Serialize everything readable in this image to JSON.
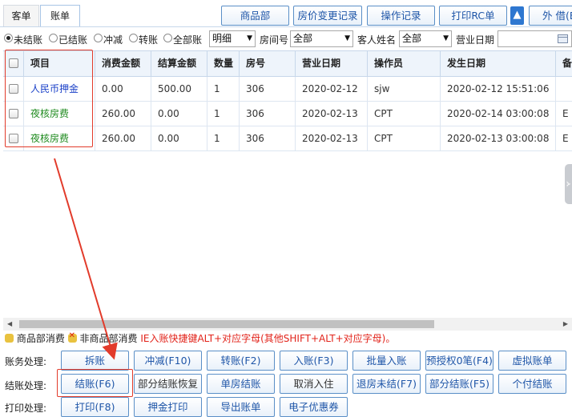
{
  "tabs": [
    {
      "label": "客单",
      "active": false
    },
    {
      "label": "账单",
      "active": true
    }
  ],
  "toolbar": {
    "buttons": [
      "商品部",
      "房价变更记录",
      "操作记录",
      "打印RC单"
    ],
    "up_icon": "▲",
    "partial": "外 借(B)"
  },
  "filter": {
    "radios": [
      {
        "label": "未结账",
        "checked": true
      },
      {
        "label": "已结账",
        "checked": false
      },
      {
        "label": "冲减",
        "checked": false
      },
      {
        "label": "转账",
        "checked": false
      },
      {
        "label": "全部账",
        "checked": false
      }
    ],
    "detail_select": "明细",
    "room_label": "房间号",
    "room_select": "全部",
    "guest_label": "客人姓名",
    "guest_select": "全部",
    "date_label": "营业日期",
    "date_value": ""
  },
  "table": {
    "columns": [
      "项目",
      "消费金额",
      "结算金额",
      "数量",
      "房号",
      "营业日期",
      "操作员",
      "发生日期",
      "备"
    ],
    "rows": [
      {
        "item": "人民币押金",
        "item_color": "blue",
        "spend": "0.00",
        "settle": "500.00",
        "qty": "1",
        "room": "306",
        "bizdate": "2020-02-12",
        "operator": "sjw",
        "occurred": "2020-02-12 15:51:06",
        "extra": ""
      },
      {
        "item": "夜核房费",
        "item_color": "green",
        "spend": "260.00",
        "settle": "0.00",
        "qty": "1",
        "room": "306",
        "bizdate": "2020-02-13",
        "operator": "CPT",
        "occurred": "2020-02-14 03:00:08",
        "extra": "E"
      },
      {
        "item": "夜核房费",
        "item_color": "green",
        "spend": "260.00",
        "settle": "0.00",
        "qty": "1",
        "room": "306",
        "bizdate": "2020-02-13",
        "operator": "CPT",
        "occurred": "2020-02-13 03:00:08",
        "extra": "E"
      }
    ]
  },
  "legend": {
    "goods": "商品部消费",
    "nongoods": "非商品部消费",
    "hint": "IE入账快捷键ALT+对应字母(其他SHIFT+ALT+对应字母)。"
  },
  "operations": {
    "account_label": "账务处理:",
    "account_buttons": [
      "拆账",
      "冲减(F10)",
      "转账(F2)",
      "入账(F3)",
      "批量入账",
      "预授权0笔(F4)",
      "虚拟账单"
    ],
    "settle_label": "结账处理:",
    "settle_buttons": [
      "结账(F6)",
      "部分结账恢复",
      "单房结账",
      "取消入住",
      "退房未结(F7)",
      "部分结账(F5)",
      "个付结账"
    ],
    "print_label": "打印处理:",
    "print_buttons": [
      "打印(F8)",
      "押金打印",
      "导出账单",
      "电子优惠券"
    ]
  },
  "colors": {
    "accent": "#1f56a8",
    "highlight": "#e23b2b",
    "deposit_item": "#1a40c8",
    "room_item": "#1f8b1f"
  }
}
